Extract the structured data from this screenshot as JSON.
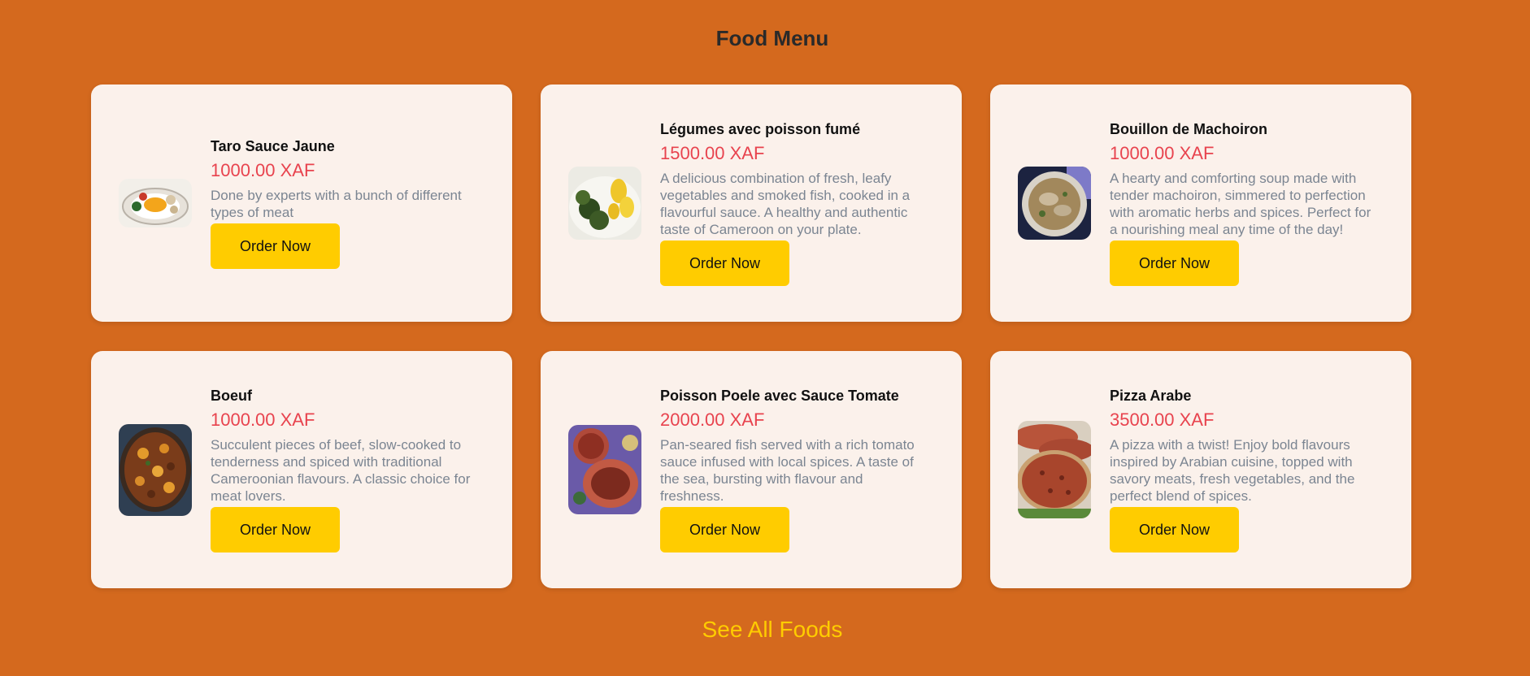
{
  "page": {
    "title": "Food Menu"
  },
  "foods": [
    {
      "name": "Taro Sauce Jaune",
      "price": "1000.00 XAF",
      "description": "Done by experts with a bunch of different types of meat",
      "button_label": "Order Now",
      "image_icon": "taro-dish-photo"
    },
    {
      "name": "Légumes avec poisson fumé",
      "price": "1500.00 XAF",
      "description": "A delicious combination of fresh, leafy vegetables and smoked fish, cooked in a flavourful sauce. A healthy and authentic taste of Cameroon on your plate.",
      "button_label": "Order Now",
      "image_icon": "vegetables-fish-photo"
    },
    {
      "name": "Bouillon de Machoiron",
      "price": "1000.00 XAF",
      "description": "A hearty and comforting soup made with tender machoiron, simmered to perfection with aromatic herbs and spices. Perfect for a nourishing meal any time of the day!",
      "button_label": "Order Now",
      "image_icon": "fish-soup-photo"
    },
    {
      "name": "Boeuf",
      "price": "1000.00 XAF",
      "description": "Succulent pieces of beef, slow-cooked to tenderness and spiced with traditional Cameroonian flavours. A classic choice for meat lovers.",
      "button_label": "Order Now",
      "image_icon": "beef-stew-photo"
    },
    {
      "name": "Poisson Poele avec Sauce Tomate",
      "price": "2000.00 XAF",
      "description": "Pan-seared fish served with a rich tomato sauce infused with local spices. A taste of the sea, bursting with flavour and freshness.",
      "button_label": "Order Now",
      "image_icon": "fried-fish-photo"
    },
    {
      "name": "Pizza Arabe",
      "price": "3500.00 XAF",
      "description": "A pizza with a twist! Enjoy bold flavours inspired by Arabian cuisine, topped with savory meats, fresh vegetables, and the perfect blend of spices.",
      "button_label": "Order Now",
      "image_icon": "pizza-photo"
    }
  ],
  "footer": {
    "see_all_label": "See All Foods"
  },
  "colors": {
    "background": "#d4691e",
    "card": "#fbf1eb",
    "price": "#e8434e",
    "button": "#ffcc00",
    "link": "#ffcc00"
  }
}
